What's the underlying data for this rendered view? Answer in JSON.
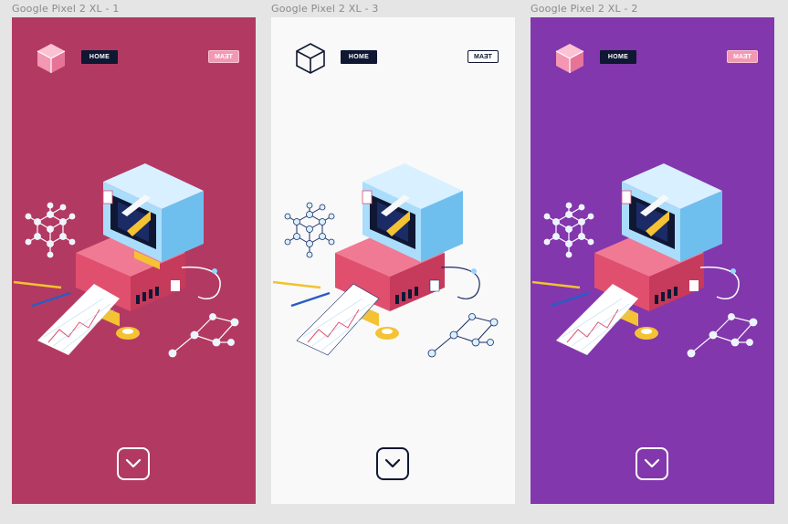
{
  "frames": [
    {
      "label": "Google Pixel 2 XL - 1",
      "background": "#b23a62",
      "home_label": "HOME",
      "team_label": "TEAM",
      "accent": "#f497b3",
      "logo_icon": "cube-icon",
      "scroll_icon": "chevron-down-icon"
    },
    {
      "label": "Google Pixel 2 XL - 3",
      "background": "#f9f9f9",
      "home_label": "HOME",
      "team_label": "TEAM",
      "accent": "#0f1733",
      "logo_icon": "cube-icon",
      "scroll_icon": "chevron-down-icon"
    },
    {
      "label": "Google Pixel 2 XL - 2",
      "background": "#8237ad",
      "home_label": "HOME",
      "team_label": "TEAM",
      "accent": "#f497b3",
      "logo_icon": "cube-icon",
      "scroll_icon": "chevron-down-icon"
    }
  ]
}
